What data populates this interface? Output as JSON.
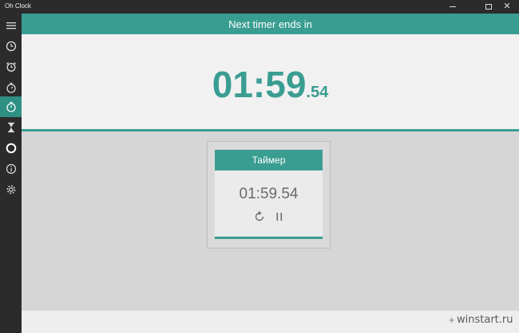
{
  "window": {
    "title": "Oh Clock"
  },
  "header": {
    "title": "Next timer ends in"
  },
  "big_timer": {
    "main": "01:59",
    "fraction": ".54"
  },
  "card": {
    "title": "Таймер",
    "time": "01:59.54"
  },
  "sidebar": {
    "items": [
      {
        "icon": "menu-icon"
      },
      {
        "icon": "clock-icon"
      },
      {
        "icon": "alarm-icon"
      },
      {
        "icon": "stopwatch-icon"
      },
      {
        "icon": "timer-icon",
        "active": true
      },
      {
        "icon": "hourglass-icon"
      },
      {
        "icon": "circle-icon"
      },
      {
        "icon": "info-icon"
      },
      {
        "icon": "settings-icon"
      }
    ]
  },
  "watermark": {
    "text": "winstart.ru"
  },
  "colors": {
    "accent": "#3a9d92",
    "sidebar": "#2b2b2b",
    "active": "#2e8f83"
  }
}
